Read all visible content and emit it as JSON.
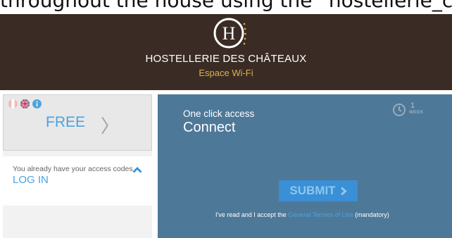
{
  "caption": {
    "text": "throughout the house using the “hostellerie_cha"
  },
  "header": {
    "brand": "HOSTELLERIE DES CHÂTEAUX",
    "subtitle": "Espace Wi-Fi",
    "colors": {
      "background": "#3a2c25",
      "subtitle": "#e0b04e"
    }
  },
  "languages": {
    "items": [
      {
        "icon": "french-flag-icon"
      },
      {
        "icon": "uk-flag-icon"
      },
      {
        "icon": "info-icon"
      }
    ]
  },
  "free_option": {
    "label": "FREE",
    "chevron": "〉"
  },
  "login": {
    "hint": "You already have your access codes",
    "label": "LOG IN"
  },
  "connect_panel": {
    "access_label": "One click access",
    "title": "Connect",
    "duration_value": "1",
    "duration_unit": "WEEK",
    "submit_label": "SUBMIT",
    "terms_prefix": "I've read and I accept the ",
    "terms_link": "General Termes of Use",
    "terms_suffix": " (mandatory)",
    "colors": {
      "panel": "#4e7898",
      "button": "#3a8fd6",
      "link": "#4aa3df"
    }
  }
}
